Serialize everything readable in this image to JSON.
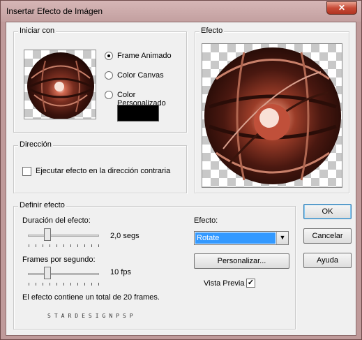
{
  "window": {
    "title": "Insertar Efecto de Imágen",
    "close_symbol": "✕"
  },
  "start_group": {
    "label": "Iniciar con",
    "options": [
      "Frame Animado",
      "Color Canvas",
      "Color Personalizado"
    ],
    "selected_index": 0,
    "custom_color": "#000000"
  },
  "effect_group": {
    "label": "Efecto"
  },
  "direction_group": {
    "label": "Dirección",
    "reverse_label": "Ejecutar efecto en la dirección contraria",
    "reverse_checked": false
  },
  "define_group": {
    "label": "Definir efecto",
    "duration_label": "Duración del efecto:",
    "duration_value": "2,0 segs",
    "duration_fraction": 0.25,
    "fps_label": "Frames por segundo:",
    "fps_value": "10 fps",
    "fps_fraction": 0.25,
    "effect_label": "Efecto:",
    "effect_selected": "Rotate",
    "customize_label": "Personalizar...",
    "preview_label": "Vista Previa",
    "preview_checked": true,
    "total_frames_text": "El efecto contiene un total de 20 frames.",
    "watermark": "STARDESIGNPSP"
  },
  "buttons": {
    "ok": "OK",
    "cancel": "Cancelar",
    "help": "Ayuda"
  },
  "colors": {
    "select_highlight": "#3399ff",
    "sphere_dark": "#2a0d08",
    "sphere_mid": "#8a3b2a",
    "sphere_light": "#f2d0c0"
  }
}
